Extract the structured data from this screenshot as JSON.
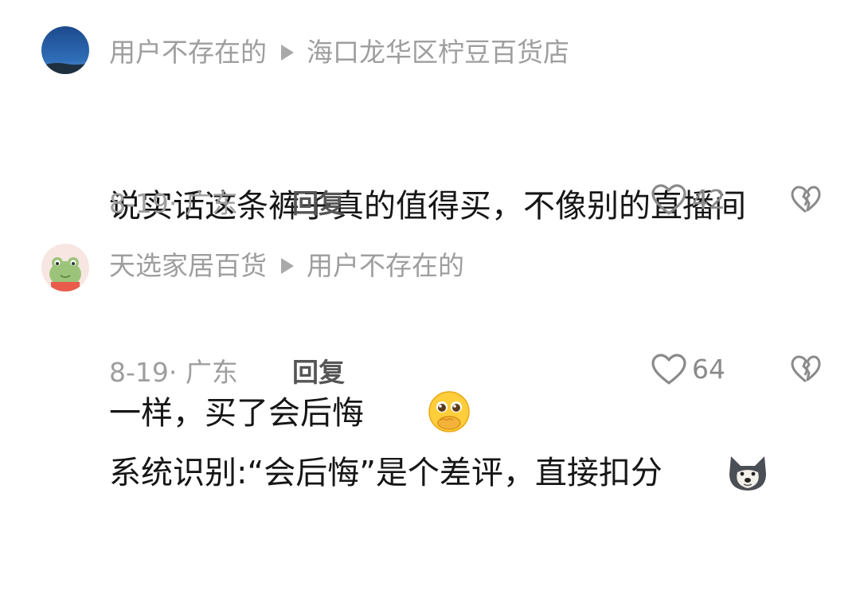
{
  "comments": [
    {
      "author": "用户不存在的",
      "reply_to": "海口龙华区柠豆百货店",
      "text_line1": "说实话这条裤子真的值得买，不像别的直播间",
      "text_line2": "一样，买了会后悔",
      "emoji": "covering-mouth-shy-emoji",
      "date_location": "8-19· 广东",
      "reply_label": "回复",
      "like_count": "42",
      "like_icon": "heart-outline-icon",
      "dislike_icon": "broken-heart-icon"
    },
    {
      "author": "天选家居百货",
      "reply_to": "用户不存在的",
      "text_line1": "系统识别:“会后悔”是个差评，直接扣分",
      "emoji": "doge-wolf-emoji",
      "date_location": "8-19· 广东",
      "reply_label": "回复",
      "like_count": "64",
      "like_icon": "heart-outline-icon",
      "dislike_icon": "broken-heart-icon"
    }
  ]
}
